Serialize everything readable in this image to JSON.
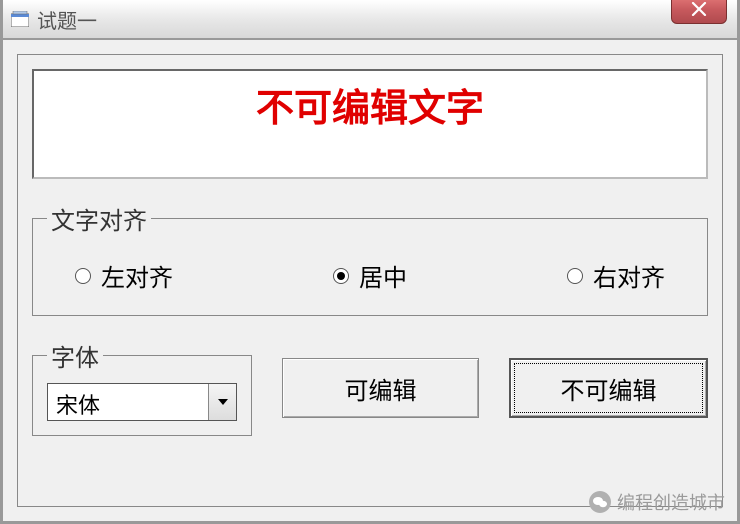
{
  "title": "试题一",
  "textbox_value": "不可编辑文字",
  "alignment": {
    "legend": "文字对齐",
    "options": [
      {
        "label": "左对齐",
        "checked": false
      },
      {
        "label": "居中",
        "checked": true
      },
      {
        "label": "右对齐",
        "checked": false
      }
    ]
  },
  "font": {
    "legend": "字体",
    "selected": "宋体"
  },
  "buttons": {
    "editable": "可编辑",
    "readonly": "不可编辑"
  },
  "watermark": "编程创造城市"
}
